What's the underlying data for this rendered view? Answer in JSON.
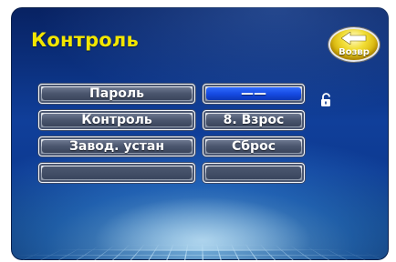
{
  "screen": {
    "title": "Контроль"
  },
  "back_button": {
    "label": "Возвр",
    "icon": "left-arrow-icon",
    "color": "#f2de36"
  },
  "menu": {
    "left_items": [
      {
        "label": "Пароль"
      },
      {
        "label": "Контроль"
      },
      {
        "label": "Завод. устан"
      },
      {
        "label": ""
      }
    ],
    "right_items": [
      {
        "label": "——",
        "active": true
      },
      {
        "label": "8. Взрос"
      },
      {
        "label": "Сброс"
      },
      {
        "label": ""
      }
    ]
  },
  "lock_icon": "open-lock-icon",
  "colors": {
    "title": "#f2e600",
    "active_field": "#1549e0",
    "background": "#0d3a92"
  }
}
